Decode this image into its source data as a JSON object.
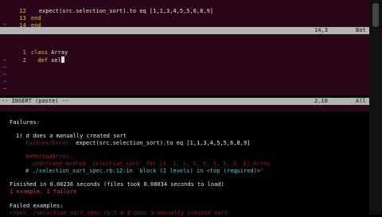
{
  "vim_top": {
    "lines": [
      {
        "num": "12",
        "text": "expect(src.selection_sort).to eq [1,1,3,4,5,5,6,8,9]"
      },
      {
        "num": "13",
        "text": "end"
      },
      {
        "num": "14",
        "text": "end"
      }
    ],
    "tilde": "~",
    "status_pos": "14,3",
    "status_scroll": "Bot"
  },
  "vim_bottom": {
    "line1_num": "1",
    "line1_kw": "class",
    "line1_name": "Array",
    "line2_num": "2",
    "line2_kw": "def",
    "line2_text": "sel",
    "mode": "-- INSERT (paste) --",
    "status_pos": "2,10",
    "status_scroll": "All"
  },
  "rspec": {
    "failures_label": "Failures:",
    "failure_title": "1) d does a manually created sort",
    "failure_line_prefix": "Failure/Error:",
    "failure_code": "expect(src.selection_sort).to eq [1,1,3,4,5,5,6,8,9]",
    "error_type": "NoMethodError:",
    "error_msg": "undefined method `selection_sort' for [4, 1, 1, 3, 9, 5, 5, 8, 6]:Array",
    "backtrace": "# ./selection_sort_spec.rb:12:in `block (2 levels) in <top (required)>'",
    "finished": "Finished in 0.00236 seconds (files took 0.08034 seconds to load)",
    "summary": "1 example, 1 failure",
    "failed_examples": "Failed examples:",
    "rerun": "rspec ./selection_sort_spec.rb:5 # d does a manually created sort"
  }
}
